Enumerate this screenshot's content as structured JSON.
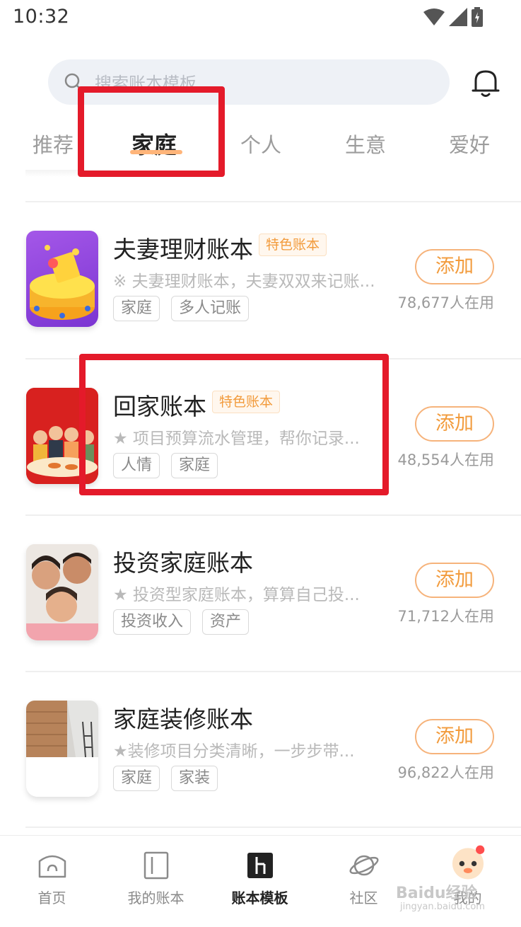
{
  "status": {
    "time": "10:32"
  },
  "search": {
    "placeholder": "搜索账本模板"
  },
  "tabs": [
    {
      "label": "推荐",
      "active": false
    },
    {
      "label": "家庭",
      "active": true
    },
    {
      "label": "个人",
      "active": false
    },
    {
      "label": "生意",
      "active": false
    },
    {
      "label": "爱好",
      "active": false
    }
  ],
  "items": [
    {
      "title": "夫妻理财账本",
      "badge": "特色账本",
      "desc": "※ 夫妻理财账本，夫妻双双来记账...",
      "tags": [
        "家庭",
        "多人记账"
      ],
      "add_label": "添加",
      "users": "78,677人在用",
      "thumb": "purple-cake"
    },
    {
      "title": "回家账本",
      "badge": "特色账本",
      "desc": "★ 项目预算流水管理，帮你记录...",
      "tags": [
        "人情",
        "家庭"
      ],
      "add_label": "添加",
      "users": "48,554人在用",
      "thumb": "family-dinner"
    },
    {
      "title": "投资家庭账本",
      "badge": "",
      "desc": "★ 投资型家庭账本，算算自己投...",
      "tags": [
        "投资收入",
        "资产"
      ],
      "add_label": "添加",
      "users": "71,712人在用",
      "thumb": "family-photo"
    },
    {
      "title": "家庭装修账本",
      "badge": "",
      "desc": "★装修项目分类清晰，一步步带...",
      "tags": [
        "家庭",
        "家装"
      ],
      "add_label": "添加",
      "users": "96,822人在用",
      "thumb": "brick-wall"
    }
  ],
  "nav": [
    {
      "label": "首页",
      "icon": "home-icon",
      "active": false
    },
    {
      "label": "我的账本",
      "icon": "book-icon",
      "active": false
    },
    {
      "label": "账本模板",
      "icon": "template-icon",
      "active": true
    },
    {
      "label": "社区",
      "icon": "planet-icon",
      "active": false
    },
    {
      "label": "我的",
      "icon": "avatar-icon",
      "active": false
    }
  ],
  "watermark": {
    "text": "Baidu经验",
    "sub": "jingyan.baidu.com"
  },
  "colors": {
    "accent": "#f29b3c",
    "annotation": "#e41a2a"
  }
}
